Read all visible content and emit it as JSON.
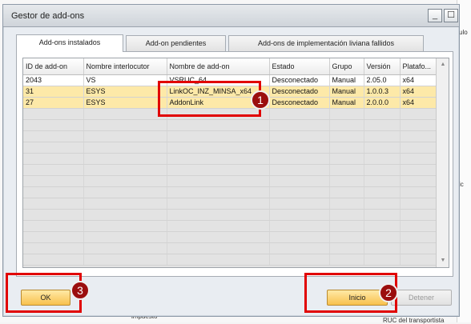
{
  "window": {
    "title": "Gestor de add-ons",
    "minimize_glyph": "_",
    "maximize_glyph": "☐"
  },
  "background": {
    "right_fragments": [
      "ulo",
      "ic"
    ],
    "bottom_fragments": [
      "impuesto",
      "RUC del transportista"
    ]
  },
  "tabs": [
    {
      "label": "Add-ons instalados",
      "active": true
    },
    {
      "label": "Add-on pendientes",
      "active": false
    },
    {
      "label": "Add-ons de implementación liviana fallidos",
      "active": false
    }
  ],
  "grid": {
    "columns": [
      "ID de add-on",
      "Nombre interlocutor",
      "Nombre de add-on",
      "Estado",
      "Grupo",
      "Versión",
      "Platafo..."
    ],
    "rows": [
      [
        "2043",
        "VS",
        "VSRUC_64",
        "Desconectado",
        "Manual",
        "2.05.0",
        "x64"
      ],
      [
        "31",
        "ESYS",
        "LinkOC_INZ_MINSA_x64",
        "Desconectado",
        "Manual",
        "1.0.0.3",
        "x64"
      ],
      [
        "27",
        "ESYS",
        "AddonLink",
        "Desconectado",
        "Manual",
        "2.0.0.0",
        "x64"
      ]
    ],
    "highlighted_rows": [
      1,
      2
    ],
    "empty_row_count": 14
  },
  "buttons": {
    "ok": "OK",
    "inicio": "Inicio",
    "detener": "Detener"
  },
  "annotations": {
    "badge1": "1",
    "badge2": "2",
    "badge3": "3",
    "color": "#e10000"
  },
  "colors": {
    "highlight_row": "#fde9a8",
    "button_accent": "#f8c14e"
  }
}
